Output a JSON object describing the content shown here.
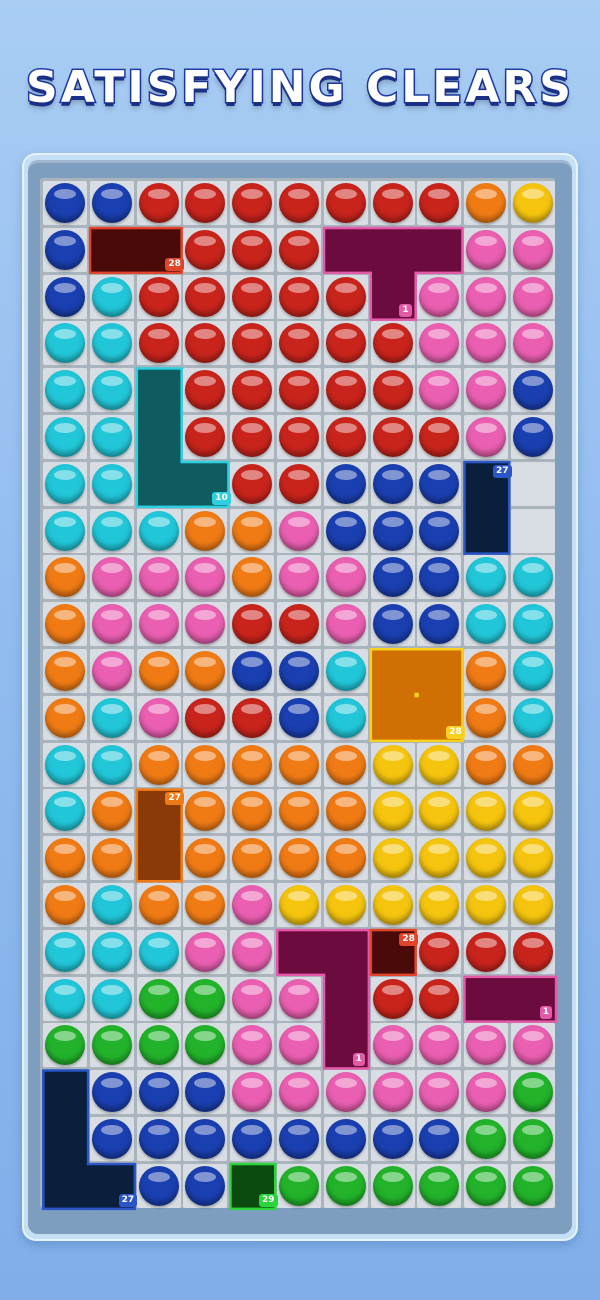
{
  "title": "SATISFYING CLEARS",
  "colors": {
    "B": "#1a3fb0",
    "R": "#c8241c",
    "O": "#f07b15",
    "Y": "#f4c40e",
    "C": "#21c6d8",
    "P": "#ea5fb1",
    "G": "#22b32a"
  },
  "grid": [
    "BBRRRRRRROY",
    "B..RRR...PP",
    "BCRRRRR.PPP",
    "CCRRRRRRPPP",
    "CC.RRRRRPPB",
    "CC.RRRRRRPB",
    "CC..RRBBB..",
    "CCCOOPBBB..",
    "OPPPOPPBBCC",
    "OPPPRRPBBCC",
    "OPOOBBC..OC",
    "OCPRRBC..OC",
    "CCOOOOOYYOO",
    "CO.OOOOYYYY",
    "OO.OOOOYYYY",
    "OCOOPYYYYYY",
    "CCCPP...RRR",
    "CCGGPP.RR..",
    "GGGGPP.PPPP",
    ".BBBPPPPPPG",
    ".BBBBBBBBGG",
    "..BB.GGGGGG"
  ],
  "pieces": [
    {
      "name": "piece-dark-red-bar",
      "color": "#4a0a0a",
      "border": "#e0452c",
      "label": "28",
      "cells": [
        [
          1,
          1
        ],
        [
          1,
          2
        ]
      ]
    },
    {
      "name": "piece-magenta-t",
      "color": "#6b0b3e",
      "border": "#e35aa8",
      "label": "1",
      "cells": [
        [
          1,
          6
        ],
        [
          1,
          7
        ],
        [
          1,
          8
        ],
        [
          2,
          7
        ]
      ]
    },
    {
      "name": "piece-teal-l",
      "color": "#0f5c60",
      "border": "#2ecfe0",
      "label": "10",
      "cells": [
        [
          4,
          2
        ],
        [
          5,
          2
        ],
        [
          6,
          2
        ],
        [
          6,
          3
        ]
      ]
    },
    {
      "name": "piece-navy-bar",
      "color": "#0a1f3c",
      "border": "#2a56c8",
      "label": "27",
      "cells": [
        [
          6,
          9
        ],
        [
          7,
          9
        ]
      ]
    },
    {
      "name": "piece-orange-square",
      "color": "#d07004",
      "border": "#f7d020",
      "label": "28",
      "cells": [
        [
          10,
          7
        ],
        [
          10,
          8
        ],
        [
          11,
          7
        ],
        [
          11,
          8
        ]
      ]
    },
    {
      "name": "piece-brown-bar",
      "color": "#8a3a06",
      "border": "#f07a16",
      "label": "27",
      "cells": [
        [
          13,
          2
        ],
        [
          14,
          2
        ]
      ]
    },
    {
      "name": "piece-magenta-l",
      "color": "#6b0b3e",
      "border": "#e35aa8",
      "label": "1",
      "cells": [
        [
          16,
          5
        ],
        [
          16,
          6
        ],
        [
          17,
          6
        ],
        [
          18,
          6
        ]
      ]
    },
    {
      "name": "piece-dark-red-square",
      "color": "#4a0a0a",
      "border": "#e0452c",
      "label": "28",
      "cells": [
        [
          16,
          7
        ]
      ]
    },
    {
      "name": "piece-magenta-bar",
      "color": "#6b0b3e",
      "border": "#e35aa8",
      "label": "1",
      "cells": [
        [
          17,
          9
        ],
        [
          17,
          10
        ]
      ]
    },
    {
      "name": "piece-navy-l",
      "color": "#0a1f3c",
      "border": "#2a56c8",
      "label": "27",
      "cells": [
        [
          19,
          0
        ],
        [
          20,
          0
        ],
        [
          21,
          0
        ],
        [
          21,
          1
        ]
      ]
    },
    {
      "name": "piece-green-square",
      "color": "#0c4b10",
      "border": "#2ad43a",
      "label": "29",
      "cells": [
        [
          21,
          4
        ]
      ]
    }
  ]
}
